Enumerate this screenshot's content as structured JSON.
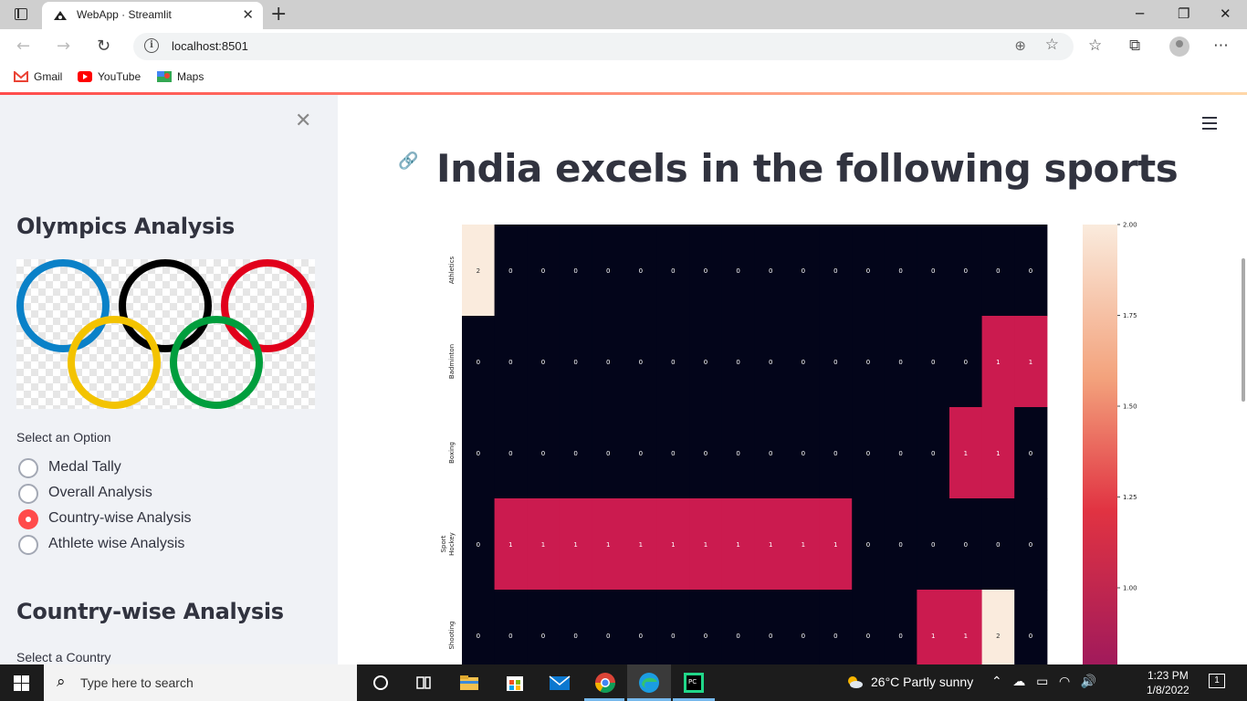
{
  "browser": {
    "tab_title": "WebApp · Streamlit",
    "url": "localhost:8501",
    "bookmarks": [
      "Gmail",
      "YouTube",
      "Maps"
    ]
  },
  "sidebar": {
    "title": "Olympics Analysis",
    "select_label": "Select an Option",
    "options": [
      "Medal Tally",
      "Overall Analysis",
      "Country-wise Analysis",
      "Athlete wise Analysis"
    ],
    "selected_option": "Country-wise Analysis",
    "subheader": "Country-wise Analysis",
    "country_label": "Select a Country"
  },
  "main": {
    "title": "India excels in the following sports"
  },
  "chart_data": {
    "type": "heatmap",
    "ylabel": "Sport",
    "rows": [
      "Athletics",
      "Badminton",
      "Boxing",
      "Hockey",
      "Shooting"
    ],
    "values": [
      [
        2,
        0,
        0,
        0,
        0,
        0,
        0,
        0,
        0,
        0,
        0,
        0,
        0,
        0,
        0,
        0,
        0,
        0
      ],
      [
        0,
        0,
        0,
        0,
        0,
        0,
        0,
        0,
        0,
        0,
        0,
        0,
        0,
        0,
        0,
        0,
        1,
        1
      ],
      [
        0,
        0,
        0,
        0,
        0,
        0,
        0,
        0,
        0,
        0,
        0,
        0,
        0,
        0,
        0,
        1,
        1,
        0
      ],
      [
        0,
        1,
        1,
        1,
        1,
        1,
        1,
        1,
        1,
        1,
        1,
        1,
        0,
        0,
        0,
        0,
        0,
        0
      ],
      [
        0,
        0,
        0,
        0,
        0,
        0,
        0,
        0,
        0,
        0,
        0,
        0,
        0,
        0,
        1,
        1,
        2,
        0
      ]
    ],
    "colorbar_ticks": [
      "2.00",
      "1.75",
      "1.50",
      "1.25",
      "1.00"
    ],
    "colors": {
      "zero": "#03051a",
      "one": "#cb1b4f",
      "two": "#faebdd",
      "mid": "#e13342"
    }
  },
  "taskbar": {
    "search_placeholder": "Type here to search",
    "weather": "26°C  Partly sunny",
    "time": "1:23 PM",
    "date": "1/8/2022",
    "notifications": "1"
  }
}
